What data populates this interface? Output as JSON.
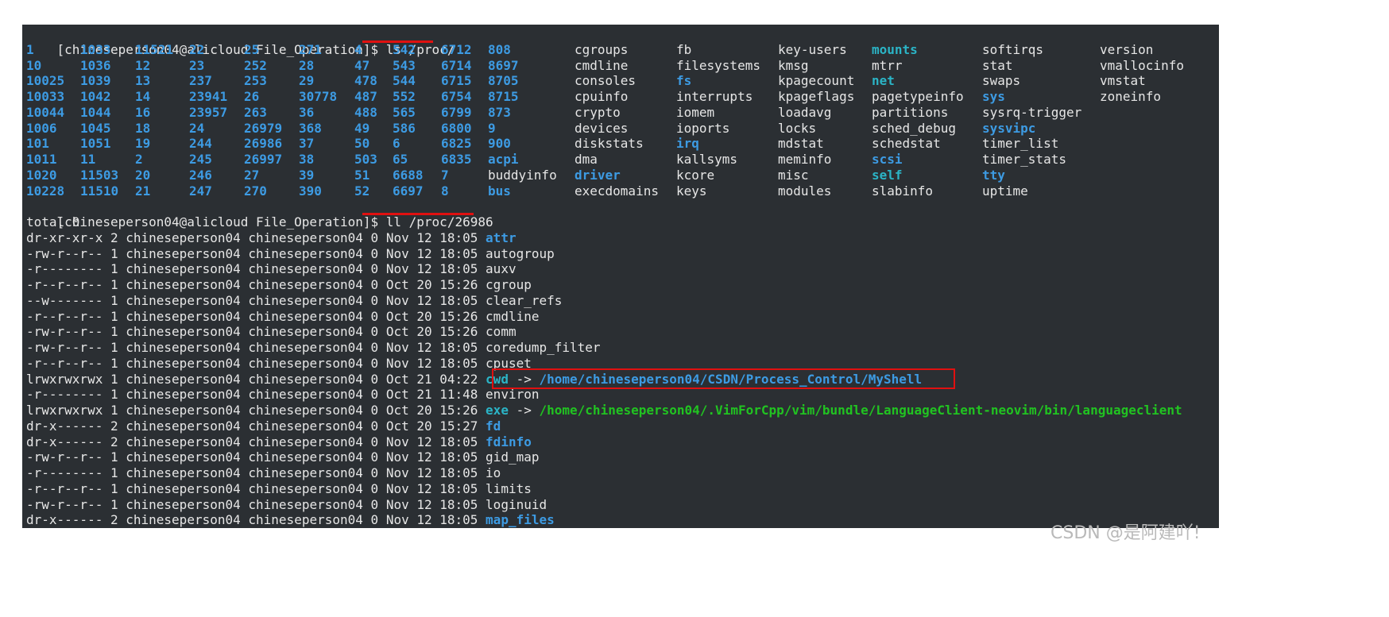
{
  "terminal": {
    "prompt1": "[chineseperson04@alicloud File_Operation]$ ",
    "command1": "ls /proc/",
    "proc_rows": [
      [
        {
          "t": "1",
          "c": "dir"
        },
        {
          "t": "1033",
          "c": "dir"
        },
        {
          "t": "11521",
          "c": "dir"
        },
        {
          "t": "22",
          "c": "dir"
        },
        {
          "t": "25",
          "c": "dir"
        },
        {
          "t": "271",
          "c": "dir"
        },
        {
          "t": "4",
          "c": "dir"
        },
        {
          "t": "542",
          "c": "dir"
        },
        {
          "t": "6712",
          "c": "dir"
        },
        {
          "t": "808",
          "c": "dir"
        },
        {
          "t": "cgroups",
          "c": ""
        },
        {
          "t": "fb",
          "c": ""
        },
        {
          "t": "key-users",
          "c": ""
        },
        {
          "t": "mounts",
          "c": "link"
        },
        {
          "t": "softirqs",
          "c": ""
        },
        {
          "t": "version",
          "c": ""
        }
      ],
      [
        {
          "t": "10",
          "c": "dir"
        },
        {
          "t": "1036",
          "c": "dir"
        },
        {
          "t": "12",
          "c": "dir"
        },
        {
          "t": "23",
          "c": "dir"
        },
        {
          "t": "252",
          "c": "dir"
        },
        {
          "t": "28",
          "c": "dir"
        },
        {
          "t": "47",
          "c": "dir"
        },
        {
          "t": "543",
          "c": "dir"
        },
        {
          "t": "6714",
          "c": "dir"
        },
        {
          "t": "8697",
          "c": "dir"
        },
        {
          "t": "cmdline",
          "c": ""
        },
        {
          "t": "filesystems",
          "c": ""
        },
        {
          "t": "kmsg",
          "c": ""
        },
        {
          "t": "mtrr",
          "c": ""
        },
        {
          "t": "stat",
          "c": ""
        },
        {
          "t": "vmallocinfo",
          "c": ""
        }
      ],
      [
        {
          "t": "10025",
          "c": "dir"
        },
        {
          "t": "1039",
          "c": "dir"
        },
        {
          "t": "13",
          "c": "dir"
        },
        {
          "t": "237",
          "c": "dir"
        },
        {
          "t": "253",
          "c": "dir"
        },
        {
          "t": "29",
          "c": "dir"
        },
        {
          "t": "478",
          "c": "dir"
        },
        {
          "t": "544",
          "c": "dir"
        },
        {
          "t": "6715",
          "c": "dir"
        },
        {
          "t": "8705",
          "c": "dir"
        },
        {
          "t": "consoles",
          "c": ""
        },
        {
          "t": "fs",
          "c": "dir"
        },
        {
          "t": "kpagecount",
          "c": ""
        },
        {
          "t": "net",
          "c": "link"
        },
        {
          "t": "swaps",
          "c": ""
        },
        {
          "t": "vmstat",
          "c": ""
        }
      ],
      [
        {
          "t": "10033",
          "c": "dir"
        },
        {
          "t": "1042",
          "c": "dir"
        },
        {
          "t": "14",
          "c": "dir"
        },
        {
          "t": "23941",
          "c": "dir"
        },
        {
          "t": "26",
          "c": "dir"
        },
        {
          "t": "30778",
          "c": "dir"
        },
        {
          "t": "487",
          "c": "dir"
        },
        {
          "t": "552",
          "c": "dir"
        },
        {
          "t": "6754",
          "c": "dir"
        },
        {
          "t": "8715",
          "c": "dir"
        },
        {
          "t": "cpuinfo",
          "c": ""
        },
        {
          "t": "interrupts",
          "c": ""
        },
        {
          "t": "kpageflags",
          "c": ""
        },
        {
          "t": "pagetypeinfo",
          "c": ""
        },
        {
          "t": "sys",
          "c": "dir"
        },
        {
          "t": "zoneinfo",
          "c": ""
        }
      ],
      [
        {
          "t": "10044",
          "c": "dir"
        },
        {
          "t": "1044",
          "c": "dir"
        },
        {
          "t": "16",
          "c": "dir"
        },
        {
          "t": "23957",
          "c": "dir"
        },
        {
          "t": "263",
          "c": "dir"
        },
        {
          "t": "36",
          "c": "dir"
        },
        {
          "t": "488",
          "c": "dir"
        },
        {
          "t": "565",
          "c": "dir"
        },
        {
          "t": "6799",
          "c": "dir"
        },
        {
          "t": "873",
          "c": "dir"
        },
        {
          "t": "crypto",
          "c": ""
        },
        {
          "t": "iomem",
          "c": ""
        },
        {
          "t": "loadavg",
          "c": ""
        },
        {
          "t": "partitions",
          "c": ""
        },
        {
          "t": "sysrq-trigger",
          "c": ""
        },
        {
          "t": "",
          "c": ""
        }
      ],
      [
        {
          "t": "1006",
          "c": "dir"
        },
        {
          "t": "1045",
          "c": "dir"
        },
        {
          "t": "18",
          "c": "dir"
        },
        {
          "t": "24",
          "c": "dir"
        },
        {
          "t": "26979",
          "c": "dir"
        },
        {
          "t": "368",
          "c": "dir"
        },
        {
          "t": "49",
          "c": "dir"
        },
        {
          "t": "586",
          "c": "dir"
        },
        {
          "t": "6800",
          "c": "dir"
        },
        {
          "t": "9",
          "c": "dir"
        },
        {
          "t": "devices",
          "c": ""
        },
        {
          "t": "ioports",
          "c": ""
        },
        {
          "t": "locks",
          "c": ""
        },
        {
          "t": "sched_debug",
          "c": ""
        },
        {
          "t": "sysvipc",
          "c": "dir"
        },
        {
          "t": "",
          "c": ""
        }
      ],
      [
        {
          "t": "101",
          "c": "dir"
        },
        {
          "t": "1051",
          "c": "dir"
        },
        {
          "t": "19",
          "c": "dir"
        },
        {
          "t": "244",
          "c": "dir"
        },
        {
          "t": "26986",
          "c": "dir"
        },
        {
          "t": "37",
          "c": "dir"
        },
        {
          "t": "50",
          "c": "dir"
        },
        {
          "t": "6",
          "c": "dir"
        },
        {
          "t": "6825",
          "c": "dir"
        },
        {
          "t": "900",
          "c": "dir"
        },
        {
          "t": "diskstats",
          "c": ""
        },
        {
          "t": "irq",
          "c": "dir"
        },
        {
          "t": "mdstat",
          "c": ""
        },
        {
          "t": "schedstat",
          "c": ""
        },
        {
          "t": "timer_list",
          "c": ""
        },
        {
          "t": "",
          "c": ""
        }
      ],
      [
        {
          "t": "1011",
          "c": "dir"
        },
        {
          "t": "11",
          "c": "dir"
        },
        {
          "t": "2",
          "c": "dir"
        },
        {
          "t": "245",
          "c": "dir"
        },
        {
          "t": "26997",
          "c": "dir"
        },
        {
          "t": "38",
          "c": "dir"
        },
        {
          "t": "503",
          "c": "dir"
        },
        {
          "t": "65",
          "c": "dir"
        },
        {
          "t": "6835",
          "c": "dir"
        },
        {
          "t": "acpi",
          "c": "dir"
        },
        {
          "t": "dma",
          "c": ""
        },
        {
          "t": "kallsyms",
          "c": ""
        },
        {
          "t": "meminfo",
          "c": ""
        },
        {
          "t": "scsi",
          "c": "dir"
        },
        {
          "t": "timer_stats",
          "c": ""
        },
        {
          "t": "",
          "c": ""
        }
      ],
      [
        {
          "t": "1020",
          "c": "dir"
        },
        {
          "t": "11503",
          "c": "dir"
        },
        {
          "t": "20",
          "c": "dir"
        },
        {
          "t": "246",
          "c": "dir"
        },
        {
          "t": "27",
          "c": "dir"
        },
        {
          "t": "39",
          "c": "dir"
        },
        {
          "t": "51",
          "c": "dir"
        },
        {
          "t": "6688",
          "c": "dir"
        },
        {
          "t": "7",
          "c": "dir"
        },
        {
          "t": "buddyinfo",
          "c": ""
        },
        {
          "t": "driver",
          "c": "dir"
        },
        {
          "t": "kcore",
          "c": ""
        },
        {
          "t": "misc",
          "c": ""
        },
        {
          "t": "self",
          "c": "link"
        },
        {
          "t": "tty",
          "c": "dir"
        },
        {
          "t": "",
          "c": ""
        }
      ],
      [
        {
          "t": "10228",
          "c": "dir"
        },
        {
          "t": "11510",
          "c": "dir"
        },
        {
          "t": "21",
          "c": "dir"
        },
        {
          "t": "247",
          "c": "dir"
        },
        {
          "t": "270",
          "c": "dir"
        },
        {
          "t": "390",
          "c": "dir"
        },
        {
          "t": "52",
          "c": "dir"
        },
        {
          "t": "6697",
          "c": "dir"
        },
        {
          "t": "8",
          "c": "dir"
        },
        {
          "t": "bus",
          "c": "dir"
        },
        {
          "t": "execdomains",
          "c": ""
        },
        {
          "t": "keys",
          "c": ""
        },
        {
          "t": "modules",
          "c": ""
        },
        {
          "t": "slabinfo",
          "c": ""
        },
        {
          "t": "uptime",
          "c": ""
        },
        {
          "t": "",
          "c": ""
        }
      ]
    ],
    "prompt2": "[chineseperson04@alicloud File_Operation]$ ",
    "command2": "ll /proc/26986",
    "total_line": "total 0",
    "ll_entries": [
      {
        "perm": "dr-xr-xr-x",
        "links": "2",
        "owner": "chineseperson04",
        "group": "chineseperson04",
        "size": "0",
        "date": "Nov 12 18:05",
        "name": "attr",
        "type": "dir",
        "target": ""
      },
      {
        "perm": "-rw-r--r--",
        "links": "1",
        "owner": "chineseperson04",
        "group": "chineseperson04",
        "size": "0",
        "date": "Nov 12 18:05",
        "name": "autogroup",
        "type": "file",
        "target": ""
      },
      {
        "perm": "-r--------",
        "links": "1",
        "owner": "chineseperson04",
        "group": "chineseperson04",
        "size": "0",
        "date": "Nov 12 18:05",
        "name": "auxv",
        "type": "file",
        "target": ""
      },
      {
        "perm": "-r--r--r--",
        "links": "1",
        "owner": "chineseperson04",
        "group": "chineseperson04",
        "size": "0",
        "date": "Oct 20 15:26",
        "name": "cgroup",
        "type": "file",
        "target": ""
      },
      {
        "perm": "--w-------",
        "links": "1",
        "owner": "chineseperson04",
        "group": "chineseperson04",
        "size": "0",
        "date": "Nov 12 18:05",
        "name": "clear_refs",
        "type": "file",
        "target": ""
      },
      {
        "perm": "-r--r--r--",
        "links": "1",
        "owner": "chineseperson04",
        "group": "chineseperson04",
        "size": "0",
        "date": "Oct 20 15:26",
        "name": "cmdline",
        "type": "file",
        "target": ""
      },
      {
        "perm": "-rw-r--r--",
        "links": "1",
        "owner": "chineseperson04",
        "group": "chineseperson04",
        "size": "0",
        "date": "Oct 20 15:26",
        "name": "comm",
        "type": "file",
        "target": ""
      },
      {
        "perm": "-rw-r--r--",
        "links": "1",
        "owner": "chineseperson04",
        "group": "chineseperson04",
        "size": "0",
        "date": "Nov 12 18:05",
        "name": "coredump_filter",
        "type": "file",
        "target": ""
      },
      {
        "perm": "-r--r--r--",
        "links": "1",
        "owner": "chineseperson04",
        "group": "chineseperson04",
        "size": "0",
        "date": "Nov 12 18:05",
        "name": "cpuset",
        "type": "file",
        "target": ""
      },
      {
        "perm": "lrwxrwxrwx",
        "links": "1",
        "owner": "chineseperson04",
        "group": "chineseperson04",
        "size": "0",
        "date": "Oct 21 04:22",
        "name": "cwd",
        "type": "link",
        "target": "/home/chineseperson04/CSDN/Process_Control/MyShell",
        "target_class": "target-dir",
        "highlight": true
      },
      {
        "perm": "-r--------",
        "links": "1",
        "owner": "chineseperson04",
        "group": "chineseperson04",
        "size": "0",
        "date": "Oct 21 11:48",
        "name": "environ",
        "type": "file",
        "target": ""
      },
      {
        "perm": "lrwxrwxrwx",
        "links": "1",
        "owner": "chineseperson04",
        "group": "chineseperson04",
        "size": "0",
        "date": "Oct 20 15:26",
        "name": "exe",
        "type": "link",
        "target": "/home/chineseperson04/.VimForCpp/vim/bundle/LanguageClient-neovim/bin/languageclient",
        "target_class": "target-exe"
      },
      {
        "perm": "dr-x------",
        "links": "2",
        "owner": "chineseperson04",
        "group": "chineseperson04",
        "size": "0",
        "date": "Oct 20 15:27",
        "name": "fd",
        "type": "dir",
        "target": ""
      },
      {
        "perm": "dr-x------",
        "links": "2",
        "owner": "chineseperson04",
        "group": "chineseperson04",
        "size": "0",
        "date": "Nov 12 18:05",
        "name": "fdinfo",
        "type": "dir",
        "target": ""
      },
      {
        "perm": "-rw-r--r--",
        "links": "1",
        "owner": "chineseperson04",
        "group": "chineseperson04",
        "size": "0",
        "date": "Nov 12 18:05",
        "name": "gid_map",
        "type": "file",
        "target": ""
      },
      {
        "perm": "-r--------",
        "links": "1",
        "owner": "chineseperson04",
        "group": "chineseperson04",
        "size": "0",
        "date": "Nov 12 18:05",
        "name": "io",
        "type": "file",
        "target": ""
      },
      {
        "perm": "-r--r--r--",
        "links": "1",
        "owner": "chineseperson04",
        "group": "chineseperson04",
        "size": "0",
        "date": "Nov 12 18:05",
        "name": "limits",
        "type": "file",
        "target": ""
      },
      {
        "perm": "-rw-r--r--",
        "links": "1",
        "owner": "chineseperson04",
        "group": "chineseperson04",
        "size": "0",
        "date": "Nov 12 18:05",
        "name": "loginuid",
        "type": "file",
        "target": ""
      },
      {
        "perm": "dr-x------",
        "links": "2",
        "owner": "chineseperson04",
        "group": "chineseperson04",
        "size": "0",
        "date": "Nov 12 18:05",
        "name": "map_files",
        "type": "dir",
        "target": ""
      }
    ],
    "arrow": "->"
  },
  "watermark": "CSDN @是阿建吖!",
  "colors": {
    "background": "#2b2f33",
    "text": "#e6e6e6",
    "directory": "#3d9be3",
    "symlink": "#2bb4c6",
    "executable": "#21c321",
    "annotation_red": "#e01010"
  }
}
